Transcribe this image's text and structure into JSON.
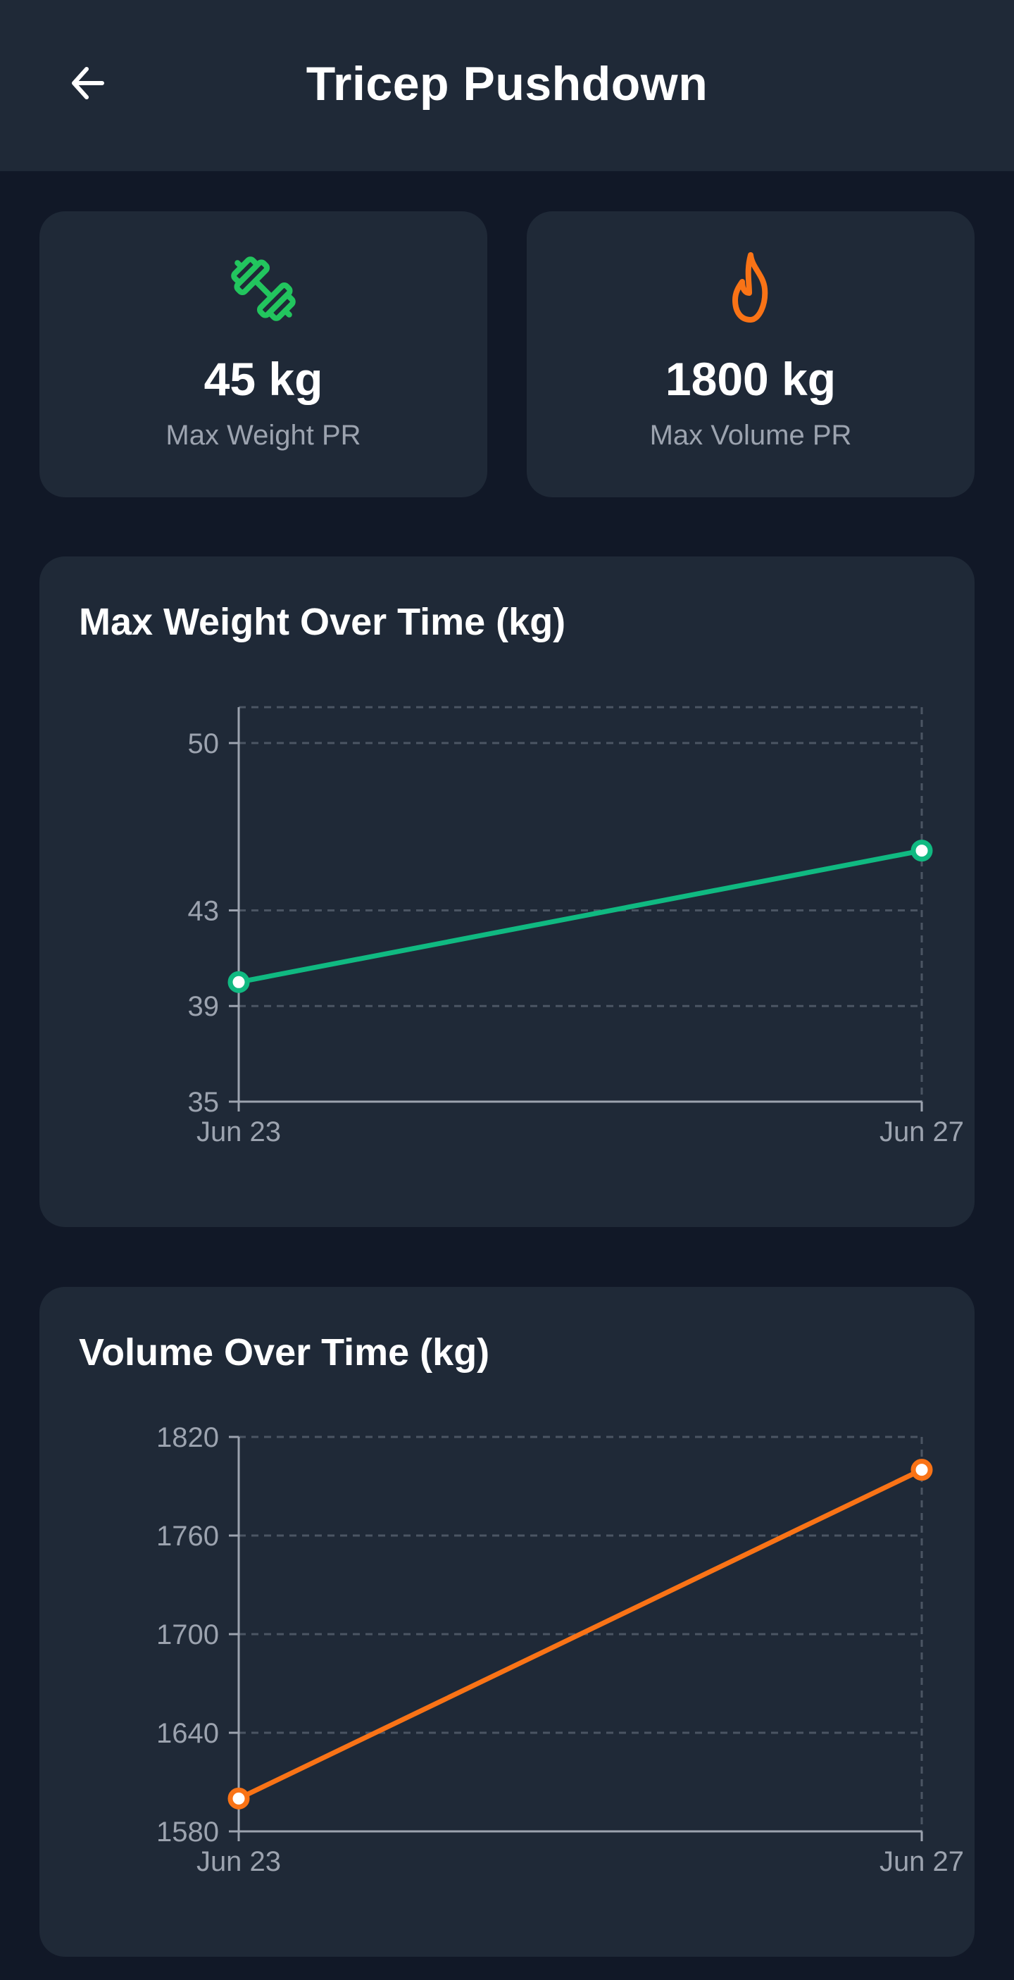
{
  "header": {
    "title": "Tricep Pushdown",
    "back_icon": "arrow-left-icon"
  },
  "stats": [
    {
      "icon": "dumbbell-icon",
      "icon_color": "#22c55e",
      "value": "45 kg",
      "label": "Max Weight PR"
    },
    {
      "icon": "flame-icon",
      "icon_color": "#f97316",
      "value": "1800 kg",
      "label": "Max Volume PR"
    }
  ],
  "charts": [
    {
      "title": "Max Weight Over Time (kg)"
    },
    {
      "title": "Volume Over Time (kg)"
    }
  ],
  "chart_data": [
    {
      "type": "line",
      "title": "Max Weight Over Time (kg)",
      "x": [
        "Jun 23",
        "Jun 27"
      ],
      "series": [
        {
          "values": [
            40,
            45.5
          ]
        }
      ],
      "yticks": [
        35,
        39,
        43,
        50
      ],
      "ylim": [
        35,
        51.5
      ],
      "color": "#10b981",
      "grid": true
    },
    {
      "type": "line",
      "title": "Volume Over Time (kg)",
      "x": [
        "Jun 23",
        "Jun 27"
      ],
      "series": [
        {
          "values": [
            1600,
            1800
          ]
        }
      ],
      "yticks": [
        1580,
        1640,
        1700,
        1760,
        1820
      ],
      "ylim": [
        1580,
        1820
      ],
      "color": "#f97316",
      "grid": true
    }
  ]
}
